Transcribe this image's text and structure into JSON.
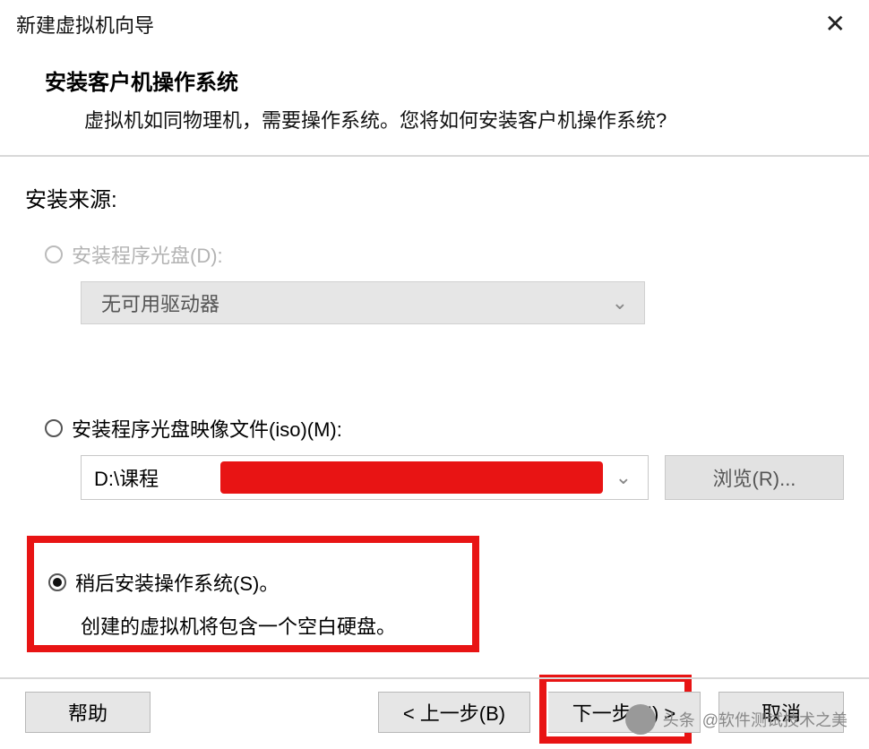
{
  "title": "新建虚拟机向导",
  "header": {
    "heading": "安装客户机操作系统",
    "subheading": "虚拟机如同物理机，需要操作系统。您将如何安装客户机操作系统?"
  },
  "body": {
    "source_label": "安装来源:",
    "disc": {
      "label": "安装程序光盘(D):",
      "dropdown": "无可用驱动器"
    },
    "iso": {
      "label": "安装程序光盘映像文件(iso)(M):",
      "path": "D:\\课程",
      "browse": "浏览(R)..."
    },
    "later": {
      "label": "稍后安装操作系统(S)。",
      "sub": "创建的虚拟机将包含一个空白硬盘。"
    }
  },
  "footer": {
    "help": "帮助",
    "back": "< 上一步(B)",
    "next": "下一步(N) >",
    "cancel": "取消"
  },
  "watermark": {
    "prefix": "头条",
    "text": "@软件测试技术之美"
  }
}
